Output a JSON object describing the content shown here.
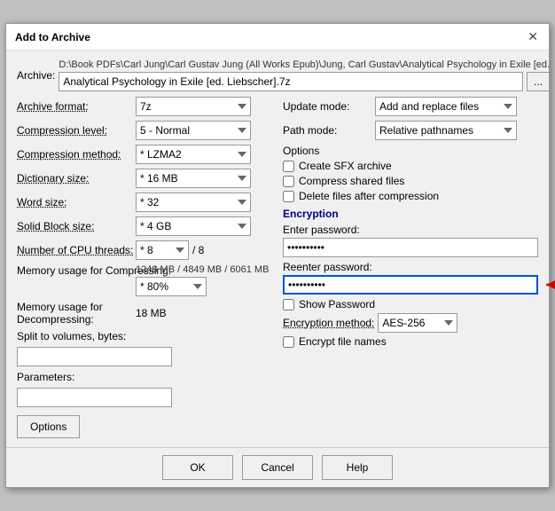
{
  "dialog": {
    "title": "Add to Archive",
    "close_label": "✕"
  },
  "archive": {
    "label": "Archive:",
    "path_text": "D:\\Book PDFs\\Carl Jung\\Carl Gustav Jung (All Works Epub)\\Jung, Carl Gustav\\Analytical Psychology in Exile [ed.",
    "input_value": "Analytical Psychology in Exile [ed. Liebscher].7z",
    "browse_label": "..."
  },
  "left": {
    "archive_format_label": "Archive format:",
    "archive_format_value": "7z",
    "compression_level_label": "Compression level:",
    "compression_level_value": "5 - Normal",
    "compression_method_label": "Compression method:",
    "compression_method_value": "* LZMA2",
    "dictionary_size_label": "Dictionary size:",
    "dictionary_size_value": "* 16 MB",
    "word_size_label": "Word size:",
    "word_size_value": "* 32",
    "solid_block_label": "Solid Block size:",
    "solid_block_value": "* 4 GB",
    "cpu_threads_label": "Number of CPU threads:",
    "cpu_threads_value": "* 8",
    "cpu_threads_of": "/ 8",
    "memory_compressing_label": "Memory usage for Compressing:",
    "memory_compressing_values": "1248 MB / 4849 MB / 6061 MB",
    "memory_pct_value": "* 80%",
    "memory_decompressing_label": "Memory usage for Decompressing:",
    "memory_decompressing_value": "18 MB",
    "split_label": "Split to volumes, bytes:",
    "split_value": "",
    "params_label": "Parameters:",
    "params_value": "",
    "options_button": "Options"
  },
  "right": {
    "update_mode_label": "Update mode:",
    "update_mode_value": "Add and replace files",
    "path_mode_label": "Path mode:",
    "path_mode_value": "Relative pathnames",
    "options_section": "Options",
    "create_sfx_label": "Create SFX archive",
    "compress_shared_label": "Compress shared files",
    "delete_files_label": "Delete files after compression",
    "encryption_section": "Encryption",
    "enter_password_label": "Enter password:",
    "enter_password_value": "••••••••••",
    "reenter_password_label": "Reenter password:",
    "reenter_password_value": "••••••••••",
    "show_password_label": "Show Password",
    "encryption_method_label": "Encryption method:",
    "encryption_method_value": "AES-256",
    "encrypt_filenames_label": "Encrypt file names"
  },
  "footer": {
    "ok_label": "OK",
    "cancel_label": "Cancel",
    "help_label": "Help"
  }
}
